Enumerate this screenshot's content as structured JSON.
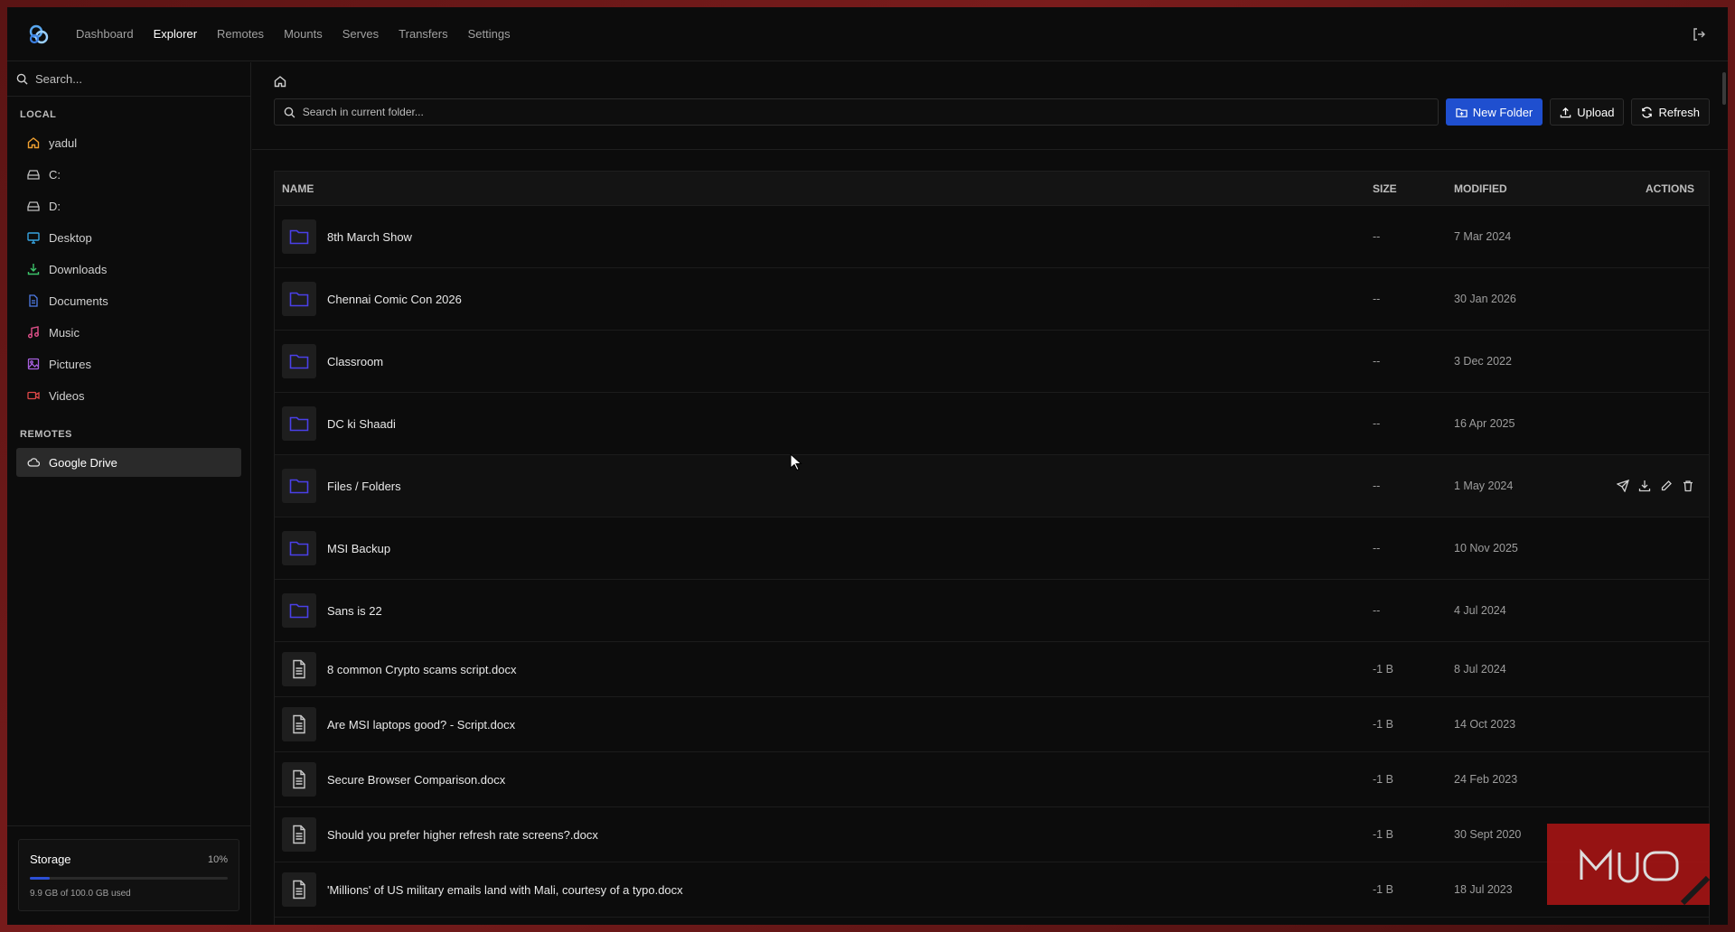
{
  "nav": {
    "items": [
      {
        "label": "Dashboard",
        "active": false
      },
      {
        "label": "Explorer",
        "active": true
      },
      {
        "label": "Remotes",
        "active": false
      },
      {
        "label": "Mounts",
        "active": false
      },
      {
        "label": "Serves",
        "active": false
      },
      {
        "label": "Transfers",
        "active": false
      },
      {
        "label": "Settings",
        "active": false
      }
    ]
  },
  "sidebar": {
    "search_placeholder": "Search...",
    "local_title": "LOCAL",
    "local_items": [
      {
        "label": "yadul",
        "icon": "home-icon",
        "color": "#f0a030"
      },
      {
        "label": "C:",
        "icon": "drive-icon",
        "color": "#bdbdbd"
      },
      {
        "label": "D:",
        "icon": "drive-icon",
        "color": "#bdbdbd"
      },
      {
        "label": "Desktop",
        "icon": "monitor-icon",
        "color": "#36a3e0"
      },
      {
        "label": "Downloads",
        "icon": "download-icon",
        "color": "#3cc46a"
      },
      {
        "label": "Documents",
        "icon": "document-icon",
        "color": "#4f7de8"
      },
      {
        "label": "Music",
        "icon": "music-icon",
        "color": "#e0508a"
      },
      {
        "label": "Pictures",
        "icon": "image-icon",
        "color": "#a860e0"
      },
      {
        "label": "Videos",
        "icon": "video-icon",
        "color": "#e04848"
      }
    ],
    "remotes_title": "REMOTES",
    "remote_items": [
      {
        "label": "Google Drive",
        "icon": "cloud-icon",
        "selected": true
      }
    ],
    "storage": {
      "label": "Storage",
      "percent_text": "10%",
      "percent": 0.1,
      "used_text": "9.9 GB of 100.0 GB used"
    }
  },
  "toolbar": {
    "search_placeholder": "Search in current folder...",
    "new_folder_label": "New Folder",
    "upload_label": "Upload",
    "refresh_label": "Refresh",
    "accent": "#1f4fcf"
  },
  "table": {
    "headers": {
      "name": "NAME",
      "size": "SIZE",
      "modified": "MODIFIED",
      "actions": "ACTIONS"
    },
    "rows": [
      {
        "type": "folder",
        "name": "8th March Show",
        "size": "--",
        "modified": "7 Mar 2024"
      },
      {
        "type": "folder",
        "name": "Chennai Comic Con 2026",
        "size": "--",
        "modified": "30 Jan 2026"
      },
      {
        "type": "folder",
        "name": "Classroom",
        "size": "--",
        "modified": "3 Dec 2022"
      },
      {
        "type": "folder",
        "name": "DC ki Shaadi",
        "size": "--",
        "modified": "16 Apr 2025"
      },
      {
        "type": "folder",
        "name": "Files / Folders",
        "size": "--",
        "modified": "1 May 2024",
        "hover": true
      },
      {
        "type": "folder",
        "name": "MSI Backup",
        "size": "--",
        "modified": "10 Nov 2025"
      },
      {
        "type": "folder",
        "name": "Sans is 22",
        "size": "--",
        "modified": "4 Jul 2024"
      },
      {
        "type": "file",
        "name": "8 common Crypto scams script.docx",
        "size": "-1 B",
        "modified": "8 Jul 2024"
      },
      {
        "type": "file",
        "name": "Are MSI laptops good? - Script.docx",
        "size": "-1 B",
        "modified": "14 Oct 2023"
      },
      {
        "type": "file",
        "name": "Secure Browser Comparison.docx",
        "size": "-1 B",
        "modified": "24 Feb 2023"
      },
      {
        "type": "file",
        "name": "Should you prefer higher refresh rate screens?.docx",
        "size": "-1 B",
        "modified": "30 Sept 2020"
      },
      {
        "type": "file",
        "name": "'Millions' of US military emails land with Mali, courtesy of a typo.docx",
        "size": "-1 B",
        "modified": "18 Jul 2023"
      }
    ]
  },
  "watermark": "MUO",
  "colors": {
    "folder": "#4a40e8",
    "background": "#0c0c0c"
  }
}
